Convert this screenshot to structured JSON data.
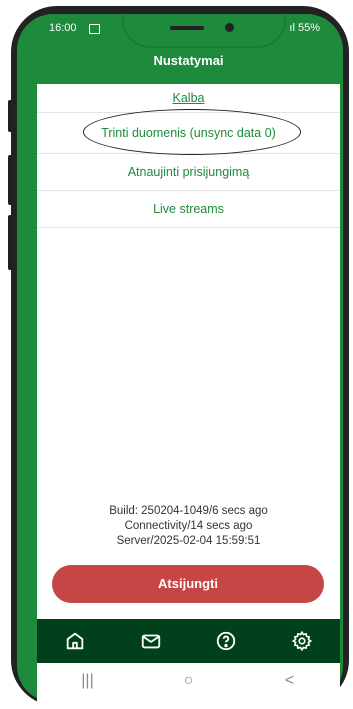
{
  "status_bar": {
    "time": "16:00",
    "right": " ıl 55%"
  },
  "header": {
    "title": "Nustatymai"
  },
  "menu": {
    "items": [
      {
        "label": "Kalba"
      },
      {
        "label": "Trinti duomenis (unsync data 0)"
      },
      {
        "label": "Atnaujinti prisijungimą"
      },
      {
        "label": "Live streams"
      }
    ]
  },
  "info": {
    "build": "Build: 250204-1049/6 secs ago",
    "connectivity": "Connectivity/14 secs ago",
    "server": "Server/2025-02-04 15:59:51"
  },
  "logout": {
    "label": "Atsijungti"
  },
  "colors": {
    "brand_green": "#1e8a3c",
    "nav_dark": "#00401a",
    "logout_red": "#c64545"
  },
  "bottom_nav": [
    "home-icon",
    "mail-icon",
    "help-icon",
    "settings-icon"
  ],
  "system_nav": {
    "recents": "|||",
    "home": "○",
    "back": "<"
  }
}
